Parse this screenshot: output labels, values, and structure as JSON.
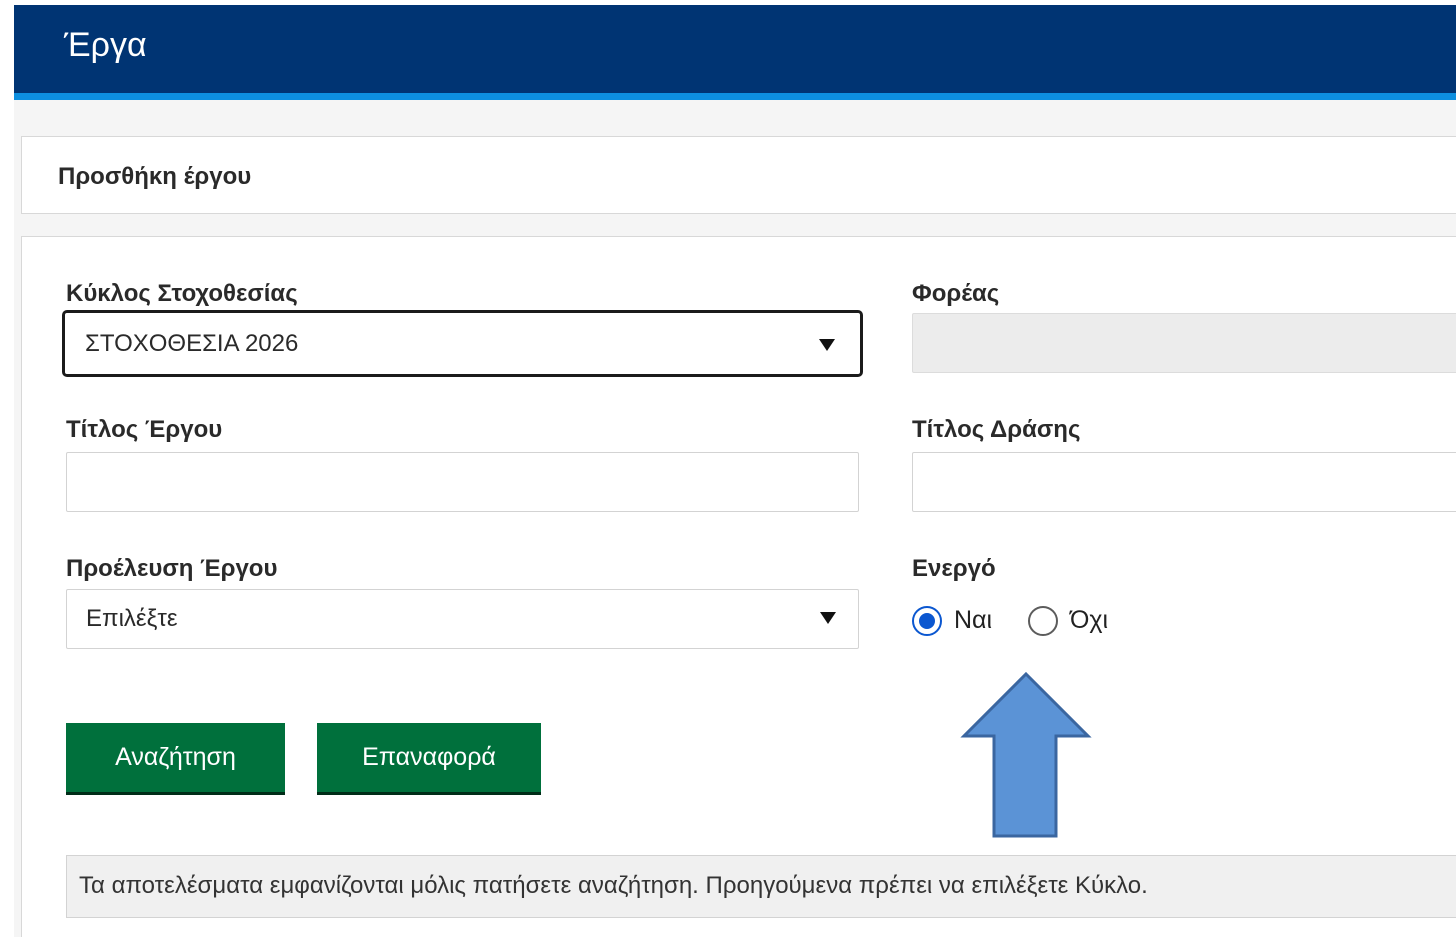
{
  "header": {
    "title": "Έργα"
  },
  "panel": {
    "title": "Προσθήκη έργου"
  },
  "form": {
    "cycle": {
      "label": "Κύκλος Στοχοθεσίας",
      "value": "ΣΤΟΧΟΘΕΣΙΑ 2026"
    },
    "agency": {
      "label": "Φορέας",
      "value": ""
    },
    "project_title": {
      "label": "Τίτλος Έργου",
      "value": ""
    },
    "action_title": {
      "label": "Τίτλος Δράσης",
      "value": ""
    },
    "project_origin": {
      "label": "Προέλευση Έργου",
      "value": "Επιλέξτε"
    },
    "active": {
      "label": "Ενεργό",
      "options": [
        {
          "label": "Ναι",
          "checked": true
        },
        {
          "label": "Όχι",
          "checked": false
        }
      ]
    }
  },
  "buttons": {
    "search": "Αναζήτηση",
    "reset": "Επαναφορά"
  },
  "info": {
    "text": "Τα αποτελέσματα εμφανίζονται μόλις πατήσετε αναζήτηση. Προηγούμενα πρέπει να επιλέξετε Κύκλο."
  },
  "colors": {
    "header_bg": "#003473",
    "header_accent": "#0d8fe0",
    "button_bg": "#00703c",
    "radio_selected": "#0b57d0",
    "annotation_arrow": "#5b93d6"
  },
  "annotation": {
    "icon": "up-arrow-icon"
  }
}
